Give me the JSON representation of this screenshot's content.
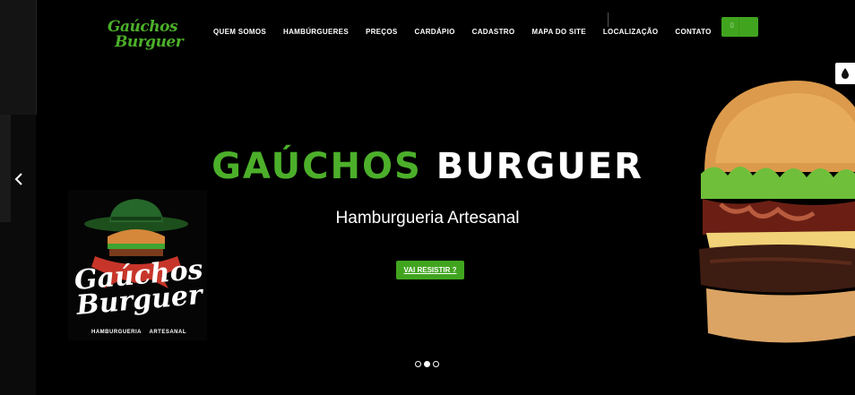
{
  "brand": {
    "line1": "Gaúchos",
    "line2": "Burguer"
  },
  "nav": {
    "items": [
      "QUEM SOMOS",
      "HAMBÚRGUERES",
      "PREÇOS",
      "CARDÁPIO",
      "CADASTRO",
      "MAPA DO SITE",
      "LOCALIZAÇÃO",
      "CONTATO"
    ]
  },
  "hero": {
    "title_green": "GAÚCHOS",
    "title_white": "BURGUER",
    "subtitle": "Hamburgueria Artesanal",
    "cta": "VAI RESISTIR ?"
  },
  "badge": {
    "line1": "Gaúchos",
    "line2": "Burguer",
    "tagline_left": "HAMBURGUERIA",
    "tagline_right": "ARTESANAL"
  },
  "carousel": {
    "slides": 3,
    "active": 2
  },
  "colors": {
    "accent": "#41a41f",
    "logo_green": "#4caf2a",
    "background": "#000000"
  },
  "icons": [
    "chevron-left-icon",
    "chevron-right-icon",
    "accessibility-contrast-icon"
  ]
}
